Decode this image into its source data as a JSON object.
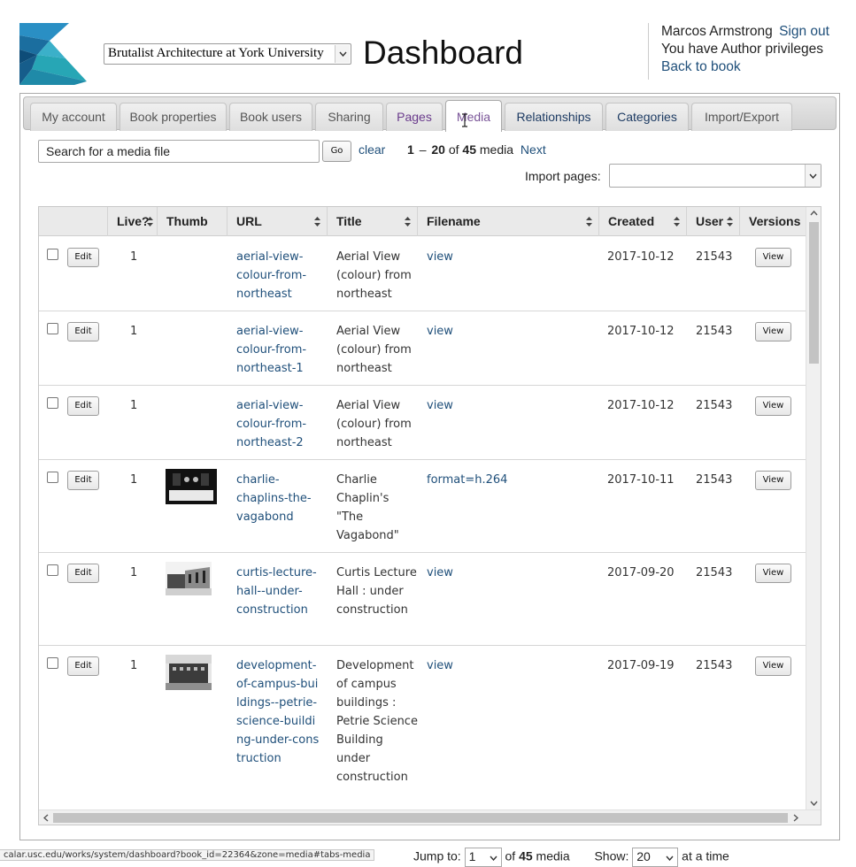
{
  "header": {
    "book_select": "Brutalist Architecture at York University",
    "title": "Dashboard",
    "user_name": "Marcos Armstrong",
    "sign_out": "Sign out",
    "privileges": "You have Author privileges",
    "back_to_book": "Back to book"
  },
  "tabs": [
    {
      "label": "My account"
    },
    {
      "label": "Book properties"
    },
    {
      "label": "Book users"
    },
    {
      "label": "Sharing"
    },
    {
      "label": "Pages"
    },
    {
      "label": "Media"
    },
    {
      "label": "Relationships"
    },
    {
      "label": "Categories"
    },
    {
      "label": "Import/Export"
    }
  ],
  "active_tab": "Media",
  "search": {
    "value": "Search for a media file",
    "go": "Go",
    "clear": "clear"
  },
  "paging": {
    "start": "1",
    "end": "20",
    "of": "of",
    "total": "45",
    "unit": "media",
    "next": "Next"
  },
  "import": {
    "label": "Import pages:"
  },
  "table": {
    "columns": [
      "Live?",
      "Thumb",
      "URL",
      "Title",
      "Filename",
      "Created",
      "User",
      "Versions"
    ],
    "edit_label": "Edit",
    "view_label": "View",
    "rows": [
      {
        "live": "1",
        "url": "aerial-view-colour-from-northeast",
        "title": "Aerial View (colour) from northeast",
        "filename": "view",
        "created": "2017-10-12",
        "user": "21543",
        "thumb": ""
      },
      {
        "live": "1",
        "url": "aerial-view-colour-from-northeast-1",
        "title": "Aerial View (colour) from northeast",
        "filename": "view",
        "created": "2017-10-12",
        "user": "21543",
        "thumb": ""
      },
      {
        "live": "1",
        "url": "aerial-view-colour-from-northeast-2",
        "title": "Aerial View (colour) from northeast",
        "filename": "view",
        "created": "2017-10-12",
        "user": "21543",
        "thumb": ""
      },
      {
        "live": "1",
        "url": "charlie-chaplins-the-vagabond",
        "title": "Charlie Chaplin's \"The Vagabond\"",
        "filename": "format=h.264",
        "created": "2017-10-11",
        "user": "21543",
        "thumb": "dark-film-still"
      },
      {
        "live": "1",
        "url": "curtis-lecture-hall--under-construction",
        "title": "Curtis Lecture Hall : under construction",
        "filename": "view",
        "created": "2017-09-20",
        "user": "21543",
        "thumb": "bw-construction-photo"
      },
      {
        "live": "1",
        "url": "development-of-campus-buildings--petrie-science-building-under-construction",
        "title": "Development of campus buildings : Petrie Science Building under construction",
        "filename": "view",
        "created": "2017-09-19",
        "user": "21543",
        "thumb": "bw-building-photo"
      }
    ]
  },
  "bottom": {
    "jump_to": "Jump to:",
    "jump_value": "1",
    "of": "of",
    "total": "45",
    "unit": "media",
    "show": "Show:",
    "show_value": "20",
    "at_a_time": "at a time"
  },
  "status_url": "calar.usc.edu/works/system/dashboard?book_id=22364&zone=media#tabs-media",
  "colors": {
    "link": "#1f4f7a",
    "active_tab": "#7a5598",
    "visited_tab": "#6a3b8c"
  }
}
